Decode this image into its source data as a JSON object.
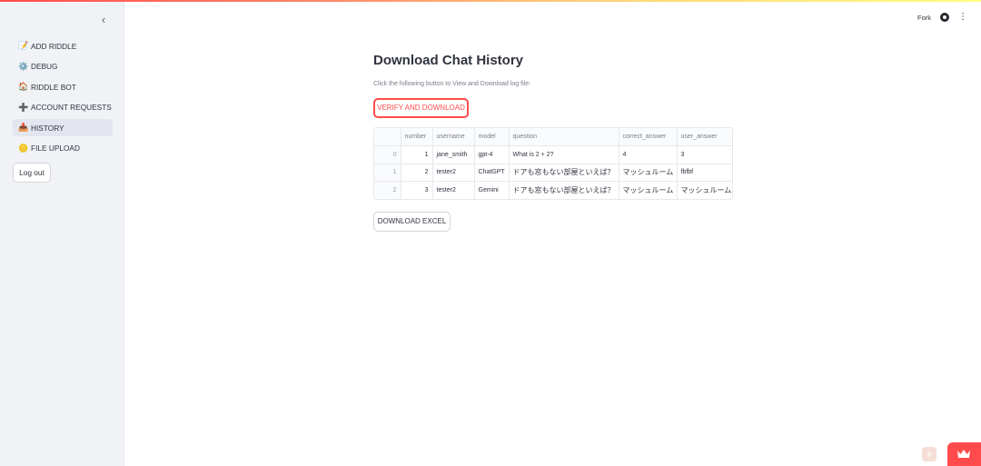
{
  "sidebar": {
    "collapse_icon": "chevron-left-icon",
    "items": [
      {
        "label": "ADD RIDDLE",
        "icon": "memo-icon",
        "glyph": "📝",
        "active": false
      },
      {
        "label": "DEBUG",
        "icon": "gear-icon",
        "glyph": "⚙️",
        "active": false
      },
      {
        "label": "RIDDLE BOT",
        "icon": "house-icon",
        "glyph": "🏠",
        "active": false
      },
      {
        "label": "ACCOUNT REQUESTS",
        "icon": "plus-icon",
        "glyph": "➕",
        "active": false
      },
      {
        "label": "HISTORY",
        "icon": "stamp-icon",
        "glyph": "📥",
        "active": true
      },
      {
        "label": "FILE UPLOAD",
        "icon": "coin-icon",
        "glyph": "🪙",
        "active": false
      }
    ],
    "logout_label": "Log out"
  },
  "header": {
    "fork_label": "Fork",
    "github_icon": "github-icon",
    "menu_icon": "kebab-menu-icon"
  },
  "main": {
    "title": "Download Chat History",
    "caption": "Click the following button to View and Download log file:",
    "verify_button": "VERIFY AND DOWNLOAD",
    "excel_button": "DOWNLOAD EXCEL",
    "table": {
      "columns": [
        "",
        "number",
        "username",
        "model",
        "question",
        "correct_answer",
        "user_answer"
      ],
      "rows": [
        [
          "0",
          "1",
          "jane_smith",
          "gpt-4",
          "What is 2 + 2?",
          "4",
          "3"
        ],
        [
          "1",
          "2",
          "tester2",
          "ChatGPT",
          "ドアも窓もない部屋といえば？",
          "マッシュルーム",
          "fbfbf"
        ],
        [
          "2",
          "3",
          "tester2",
          "Gemini",
          "ドアも窓もない部屋といえば？",
          "マッシュルーム",
          "マッシュルーム"
        ]
      ]
    }
  },
  "colors": {
    "accent": "#ff4b4b",
    "sidebar_bg": "#f0f2f6",
    "text": "#31333f",
    "muted": "#7b7e8a"
  }
}
